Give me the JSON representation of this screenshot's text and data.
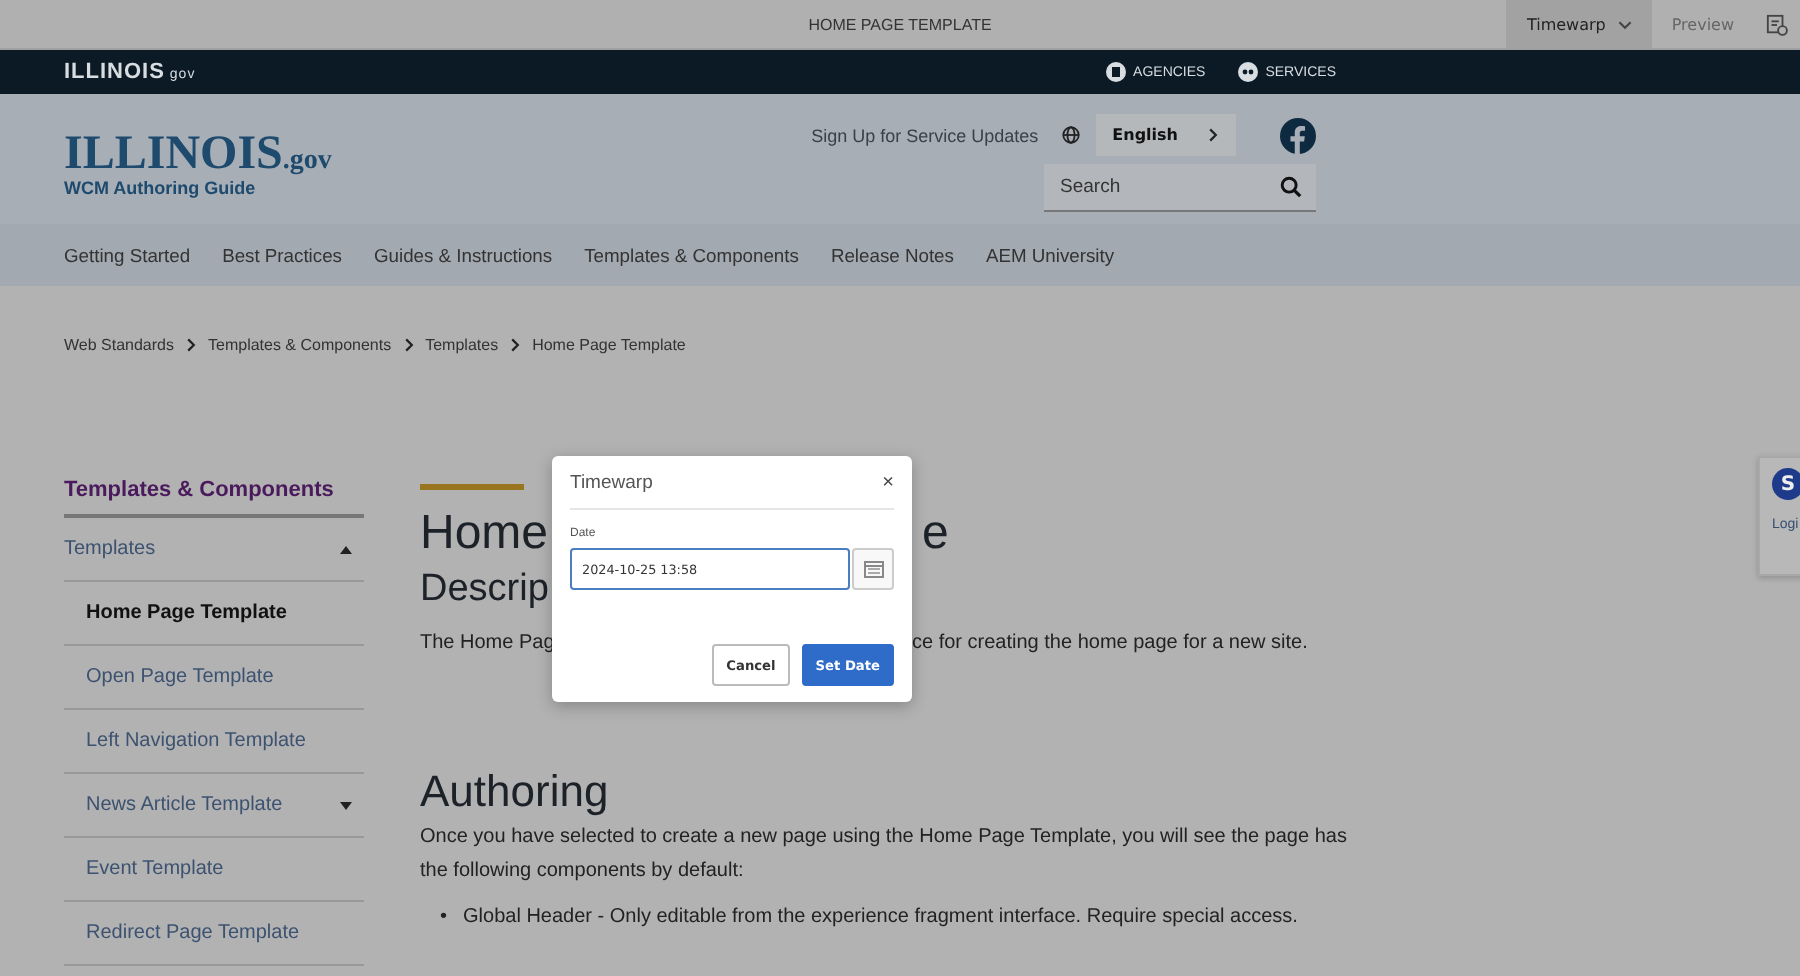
{
  "editor_bar": {
    "title": "HOME PAGE TEMPLATE",
    "modes": [
      {
        "label": "Timewarp",
        "selected": true,
        "kind": "dropdown"
      },
      {
        "label": "Preview",
        "selected": false,
        "kind": "plain"
      }
    ]
  },
  "top_bar": {
    "logo": "ILLINOIS",
    "logo_suffix": "gov",
    "links": [
      {
        "label": "AGENCIES",
        "kind": "building"
      },
      {
        "label": "SERVICES",
        "kind": "services"
      }
    ]
  },
  "header": {
    "logo": "ILLINOIS",
    "logo_suffix": ".gov",
    "subtitle": "WCM Authoring Guide",
    "signup": "Sign Up for Service Updates",
    "language": "English",
    "search": {
      "placeholder": "Search"
    }
  },
  "nav": [
    "Getting Started",
    "Best Practices",
    "Guides & Instructions",
    "Templates & Components",
    "Release Notes",
    "AEM University"
  ],
  "breadcrumb": [
    "Web Standards",
    "Templates & Components",
    "Templates",
    "Home Page Template"
  ],
  "sidebar": {
    "title": "Templates & Components",
    "items": [
      {
        "label": "Templates",
        "expanded": true,
        "selected": false,
        "children": [
          {
            "label": "Home Page Template",
            "selected": true
          },
          {
            "label": "Open Page Template",
            "selected": false
          },
          {
            "label": "Left Navigation Template",
            "selected": false
          },
          {
            "label": "News Article Template",
            "selected": false,
            "expanded": false
          },
          {
            "label": "Event Template",
            "selected": false
          },
          {
            "label": "Redirect Page Template",
            "selected": false
          }
        ]
      }
    ]
  },
  "content": {
    "title_left": "Home",
    "title_right": "e",
    "subtitle": "Descrip",
    "intro_left": "The Home Pag",
    "intro_right": "ce for creating the home page for a new site.",
    "section_title": "Authoring",
    "section_text": "Once you have selected to create a new page using the Home Page Template, you will see the page has the following components by default:",
    "bullet_marker": "•",
    "bullets": [
      "Global Header - Only editable from the experience fragment interface. Require special access."
    ]
  },
  "side_widget": {
    "badge": "S",
    "link": "Logi"
  },
  "dialog": {
    "title": "Timewarp",
    "close": "×",
    "date_label": "Date",
    "date_value": "2024-10-25 13:58",
    "buttons": [
      {
        "label": "Cancel",
        "kind": "secondary"
      },
      {
        "label": "Set Date",
        "kind": "primary"
      }
    ]
  }
}
